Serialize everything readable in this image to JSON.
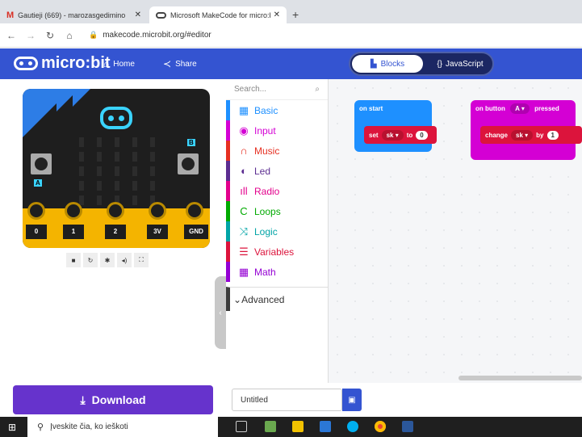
{
  "browser": {
    "tabs": [
      {
        "label": "Gautieji (669) - marozasgedimino",
        "icon": "gmail-icon"
      },
      {
        "label": "Microsoft MakeCode for micro:bit",
        "icon": "makecode-icon"
      }
    ],
    "url": "makecode.microbit.org/#editor"
  },
  "header": {
    "logo": "micro:bit",
    "home": "Home",
    "share": "Share",
    "blocks": "Blocks",
    "javascript": "JavaScript"
  },
  "simulator": {
    "button_a": "A",
    "button_b": "B",
    "pins": [
      "0",
      "1",
      "2",
      "3V",
      "GND"
    ]
  },
  "toolbox": {
    "search_placeholder": "Search...",
    "categories": [
      {
        "label": "Basic",
        "color": "#1e90ff",
        "icon": "grid-icon"
      },
      {
        "label": "Input",
        "color": "#d400d4",
        "icon": "target-icon"
      },
      {
        "label": "Music",
        "color": "#e63022",
        "icon": "headphones-icon"
      },
      {
        "label": "Led",
        "color": "#5c2d91",
        "icon": "toggle-icon"
      },
      {
        "label": "Radio",
        "color": "#e3008c",
        "icon": "signal-icon"
      },
      {
        "label": "Loops",
        "color": "#00aa00",
        "icon": "loop-icon"
      },
      {
        "label": "Logic",
        "color": "#00a4a6",
        "icon": "shuffle-icon"
      },
      {
        "label": "Variables",
        "color": "#dc143c",
        "icon": "lines-icon"
      },
      {
        "label": "Math",
        "color": "#9400d3",
        "icon": "calculator-icon"
      }
    ],
    "advanced": "Advanced"
  },
  "workspace": {
    "on_start": "on start",
    "set": "set",
    "set_var": "sk",
    "to": "to",
    "set_value": "0",
    "on_button": "on button",
    "button_choice": "A",
    "pressed": "pressed",
    "change": "change",
    "change_var": "sk",
    "by": "by",
    "change_value": "1"
  },
  "footer": {
    "download": "Download",
    "project_name": "Untitled"
  },
  "taskbar": {
    "search_placeholder": "Įveskite čia, ko ieškoti"
  }
}
